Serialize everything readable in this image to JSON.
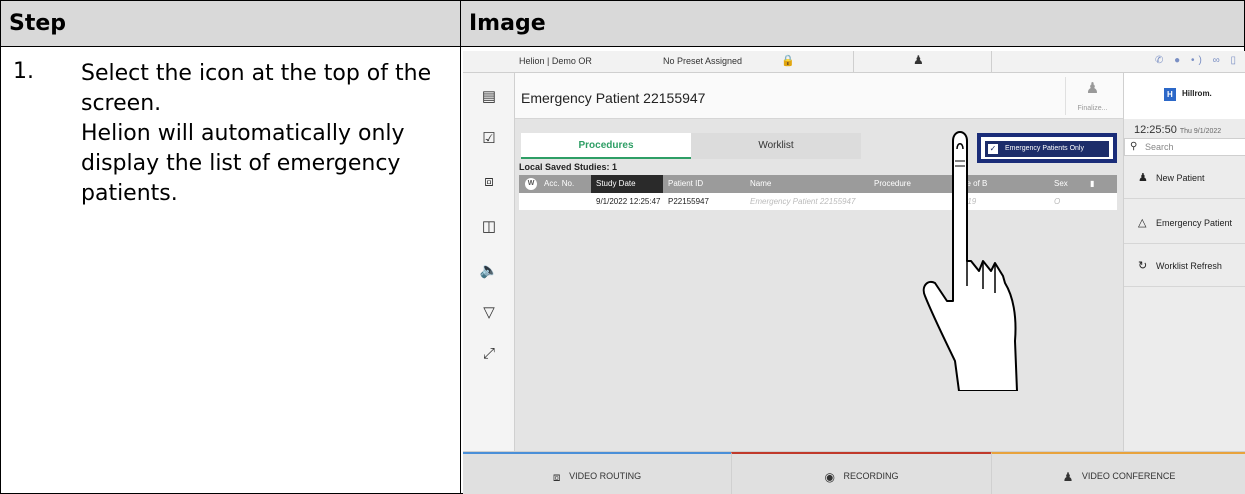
{
  "table": {
    "header_step": "Step",
    "header_image": "Image",
    "step_number": "1.",
    "step_lines": [
      "Select the icon at the top of the",
      "screen.",
      "Helion will automatically only",
      "display the list of emergency",
      "patients."
    ]
  },
  "screen": {
    "topbar": {
      "site": "Helion | Demo OR",
      "preset": "No Preset Assigned",
      "lock_icon": "lock-icon",
      "user_icon": "user-icon",
      "right_icons": "phone-icon record-icon signal-icon link-icon battery-icon"
    },
    "title": "Emergency Patient 22155947",
    "finalize_label": "Finalize...",
    "tabs": {
      "procedures": "Procedures",
      "worklist": "Worklist"
    },
    "emergency_toggle": {
      "label": "Emergency Patients Only",
      "checked": true
    },
    "saved_studies": "Local Saved Studies: 1",
    "columns": {
      "w": "W",
      "acc_no": "Acc. No.",
      "study_date": "Study Date",
      "patient_id": "Patient ID",
      "name": "Name",
      "procedure": "Procedure",
      "dob": "Date of B",
      "sex": "Sex"
    },
    "row": {
      "study_date": "9/1/2022 12:25:47",
      "patient_id": "P22155947",
      "name": "Emergency Patient 22155947",
      "dob": "1/1/19",
      "sex": "O"
    },
    "right": {
      "logo_mark": "H",
      "logo_name": "Hillrom.",
      "clock_time": "12:25:50",
      "clock_date": "Thu 9/1/2022",
      "search_placeholder": "Search",
      "new_patient": "New Patient",
      "emergency_patient": "Emergency Patient",
      "worklist_refresh": "Worklist Refresh"
    },
    "bottom": {
      "video_routing": "VIDEO ROUTING",
      "recording": "RECORDING",
      "video_conference": "VIDEO CONFERENCE"
    },
    "colors": {
      "accent_green": "#2e9e65",
      "highlight_navy": "#1a2c78",
      "routing_blue": "#4a8fd8",
      "recording_red": "#c0392b",
      "conference_orange": "#e8a33d"
    }
  }
}
